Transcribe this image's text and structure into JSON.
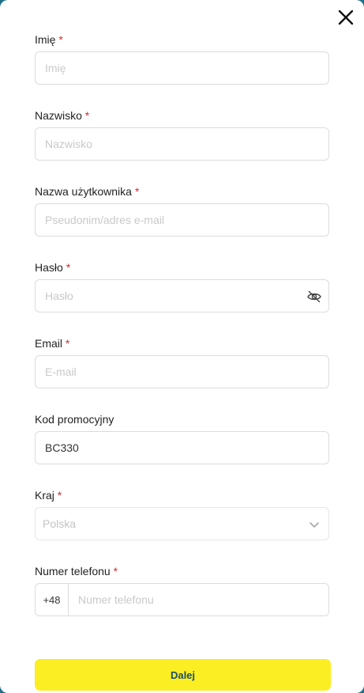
{
  "form": {
    "first_name": {
      "label": "Imię",
      "required": "*",
      "placeholder": "Imię",
      "value": ""
    },
    "last_name": {
      "label": "Nazwisko",
      "required": "*",
      "placeholder": "Nazwisko",
      "value": ""
    },
    "username": {
      "label": "Nazwa użytkownika",
      "required": "*",
      "placeholder": "Pseudonim/adres e-mail",
      "value": ""
    },
    "password": {
      "label": "Hasło",
      "required": "*",
      "placeholder": "Hasło",
      "value": "",
      "icon": "eye-slash-icon"
    },
    "email": {
      "label": "Email",
      "required": "*",
      "placeholder": "E-mail",
      "value": ""
    },
    "promo_code": {
      "label": "Kod promocyjny",
      "placeholder": "",
      "value": "BC330"
    },
    "country": {
      "label": "Kraj",
      "required": "*",
      "selected": "Polska",
      "icon": "chevron-down-icon"
    },
    "phone": {
      "label": "Numer telefonu",
      "required": "*",
      "prefix": "+48",
      "placeholder": "Numer telefonu",
      "value": ""
    },
    "submit_label": "Dalej"
  },
  "colors": {
    "required": "#d9262c",
    "submit_bg": "#fbee22",
    "submit_text": "#1b4e6b",
    "backdrop": "#1f6f8b"
  },
  "icons": {
    "close": "close-icon"
  }
}
